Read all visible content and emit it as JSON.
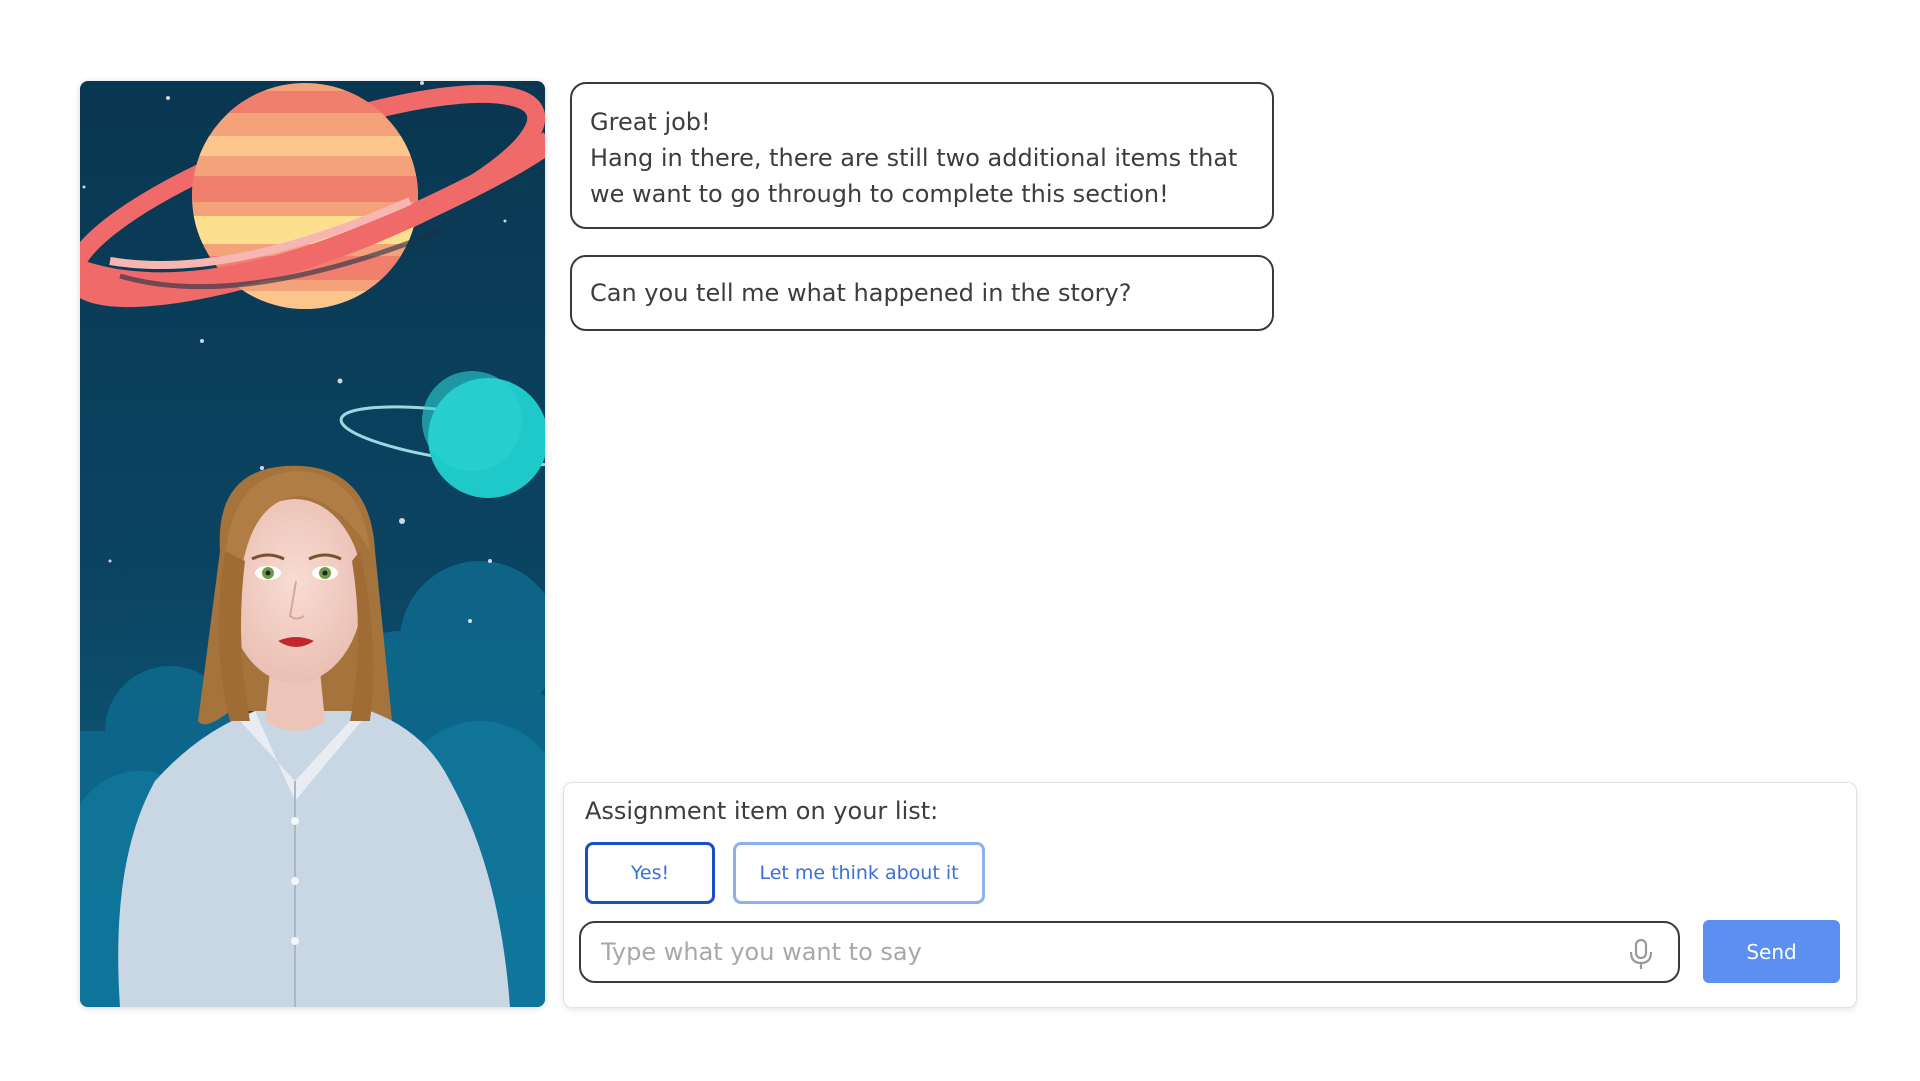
{
  "messages": [
    {
      "line1": "Great job!",
      "line2": "Hang in there, there are still two additional items that we want to go through to complete this section!"
    },
    {
      "line1": "Can you tell me what happened in the story?"
    }
  ],
  "assignment": {
    "title": "Assignment item on your list:",
    "options": [
      "Yes!",
      "Let me think about it"
    ]
  },
  "composer": {
    "placeholder": "Type what you want to say",
    "send_label": "Send",
    "mic_icon": "microphone-icon"
  },
  "colors": {
    "accent": "#5b8ff0",
    "primary_border": "#1a4fc4",
    "secondary_border": "#8fb0ef",
    "scene_background": "#0a3a55"
  }
}
